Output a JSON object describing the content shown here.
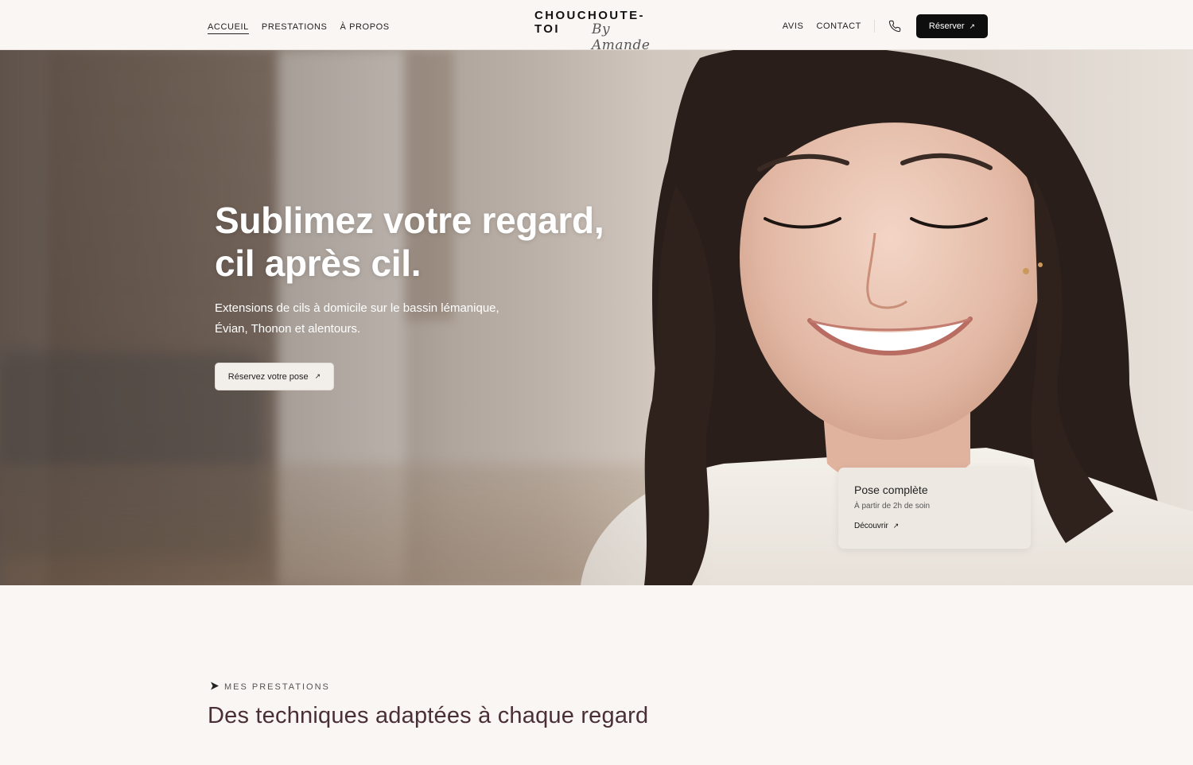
{
  "header": {
    "nav_left": [
      "ACCUEIL",
      "PRESTATIONS",
      "À PROPOS"
    ],
    "logo_main": "CHOUCHOUTE-TOI",
    "logo_script": "By Amande",
    "nav_right": [
      "AVIS",
      "CONTACT"
    ],
    "phone_icon": "phone-icon",
    "book_button": "Réserver"
  },
  "hero": {
    "title_line1": "Sublimez votre regard,",
    "title_line2": "cil après cil.",
    "subtitle_line1": "Extensions de cils à domicile sur le bassin lémanique,",
    "subtitle_line2": "Évian, Thonon et alentours.",
    "cta": "Réservez votre pose"
  },
  "card": {
    "title": "Pose complète",
    "subtitle": "À partir de 2h de soin",
    "link": "Découvrir"
  },
  "section": {
    "eyebrow": "MES PRESTATIONS",
    "title": "Des techniques adaptées à chaque regard"
  },
  "colors": {
    "background": "#faf6f3",
    "accent_dark": "#0e0e0e",
    "section_title": "#4a3036"
  }
}
